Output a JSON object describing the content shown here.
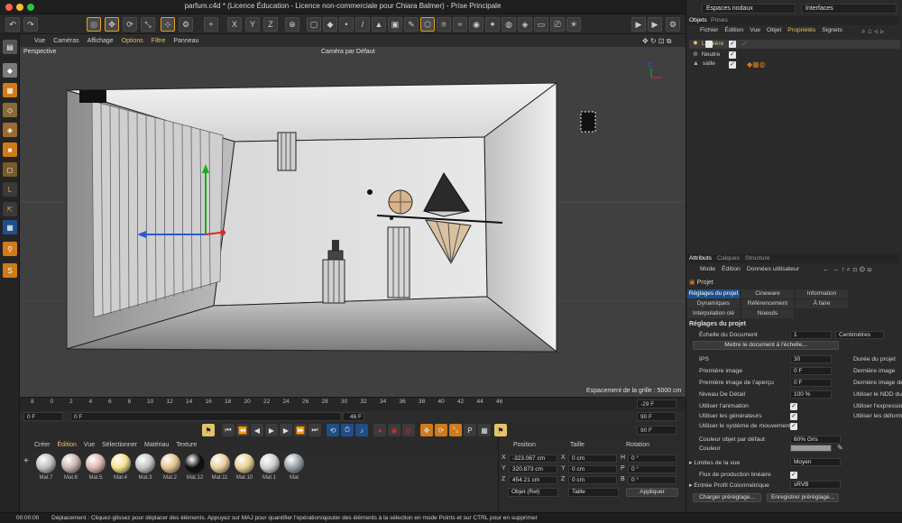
{
  "window": {
    "title": "parfum.c4d * (Licence Éducation - Licence non-commerciale pour Chiara Balmer) - Prise Principale"
  },
  "viewport": {
    "menu": [
      "Vue",
      "Caméras",
      "Affichage",
      "Options",
      "Filtre",
      "Panneau"
    ],
    "projection": "Perspective",
    "camera": "Caméra par Défaut",
    "grid_spacing": "Espacement de la grille : 5000 cm"
  },
  "timeline": {
    "ticks": [
      "8",
      "0",
      "2",
      "4",
      "6",
      "8",
      "10",
      "12",
      "14",
      "16",
      "18",
      "20",
      "22",
      "24",
      "26",
      "28",
      "30",
      "32",
      "34",
      "36",
      "38",
      "40",
      "42",
      "44",
      "46"
    ],
    "current_frame_label": "-29 F",
    "start": "0 F",
    "start2": "0 F",
    "end_preview": "46 F",
    "end": "90 F",
    "end2": "90 F"
  },
  "materials": {
    "menu": [
      "Créer",
      "Édition",
      "Vue",
      "Sélectionner",
      "Matériau",
      "Texture"
    ],
    "items": [
      {
        "label": "Mat.7",
        "color": "#bfbfbf"
      },
      {
        "label": "Mat.6",
        "color": "#c9b3ad"
      },
      {
        "label": "Mat.5",
        "color": "#d9b6b0"
      },
      {
        "label": "Mat.4",
        "color": "#f3e08a"
      },
      {
        "label": "Mat.3",
        "color": "#c4c4c4"
      },
      {
        "label": "Mat.2",
        "color": "#e2c38d"
      },
      {
        "label": "Mat.12",
        "color": "#0d0d0d"
      },
      {
        "label": "Mat.11",
        "color": "#e8cf9a"
      },
      {
        "label": "Mat.10",
        "color": "#e5cf92"
      },
      {
        "label": "Mat.1",
        "color": "#cfcfcf"
      },
      {
        "label": "Mat",
        "color": "#9aa0a6"
      }
    ]
  },
  "coordinates": {
    "headers": [
      "Position",
      "Taille",
      "Rotation"
    ],
    "rows": [
      {
        "axis": "X",
        "pos": "-323.067 cm",
        "size_axis": "X",
        "size": "0 cm",
        "rot_axis": "H",
        "rot": "0 °"
      },
      {
        "axis": "Y",
        "pos": "320.873 cm",
        "size_axis": "Y",
        "size": "0 cm",
        "rot_axis": "P",
        "rot": "0 °"
      },
      {
        "axis": "Z",
        "pos": "454.21 cm",
        "size_axis": "Z",
        "size": "0 cm",
        "rot_axis": "B",
        "rot": "0 °"
      }
    ],
    "mode": "Objet (Rel)",
    "size_mode": "Taille",
    "apply": "Appliquer"
  },
  "top_right": {
    "dropdown1": "Espaces nodaux",
    "dropdown2": "Interfaces"
  },
  "objects_panel": {
    "tabs": [
      "Objets",
      "Prises"
    ],
    "menu": [
      "Fichier",
      "Édition",
      "Vue",
      "Objet",
      "Propriétés",
      "Signets"
    ],
    "items": [
      "Lumière",
      "Neutre",
      "salle"
    ]
  },
  "attributes_panel": {
    "tabs": [
      "Attributs",
      "Calques",
      "Structure"
    ],
    "menu": [
      "Mode",
      "Édition",
      "Données utilisateur"
    ],
    "object_name": "Projet",
    "subtabs_row1": [
      "Réglages du projet",
      "Cineware",
      "Information"
    ],
    "subtabs_row2": [
      "Dynamiques",
      "Référencement",
      "À faire"
    ],
    "subtabs_row3": [
      "Interpolation clé",
      "Noeuds"
    ],
    "section_title": "Réglages du projet",
    "doc_scale_label": "Échelle du Document",
    "doc_scale_value": "1",
    "doc_scale_unit": "Centimètres",
    "scale_button": "Mettre le document à l'échelle...",
    "fields": [
      {
        "label": "IPS",
        "value": "30",
        "right_label": "Durée du projet"
      },
      {
        "label": "Première image",
        "value": "0 F",
        "right_label": "Dernière image"
      },
      {
        "label": "Première image de l'aperçu",
        "value": "0 F",
        "right_label": "Dernière image de"
      },
      {
        "label": "Niveau De Détail",
        "value": "100 %",
        "right_label": "Utiliser le NDD du"
      }
    ],
    "checks": [
      {
        "label": "Utiliser l'animation",
        "right_label": "Utiliser l'expressio"
      },
      {
        "label": "Utiliser les générateurs",
        "right_label": "Utiliser les déform"
      },
      {
        "label": "Utiliser le système de mouvement",
        "right_label": ""
      }
    ],
    "default_color_label": "Couleur objet par défaut",
    "default_color_value": "60% Gris",
    "color_label": "Couleur",
    "view_limit_label": "Limites de la vue",
    "view_limit_value": "Moyen",
    "linear_workflow_label": "Flux de production linéaire",
    "color_profile_label": "Entrée Profil Colorimétrique",
    "color_profile_value": "sRVB",
    "load_preset": "Charger préréglage...",
    "save_preset": "Enregistrer préréglage..."
  },
  "status": {
    "time": "00:00:00",
    "message": "Déplacement : Cliquez-glissez pour déplacer des éléments. Appuyez sur MAJ pour quantifier l'opération/ajouter des éléments à la sélection en mode Points et sur CTRL pour en supprimer"
  },
  "colors": {
    "accent": "#e3a21a",
    "selection_blue": "#1f4f8a"
  }
}
